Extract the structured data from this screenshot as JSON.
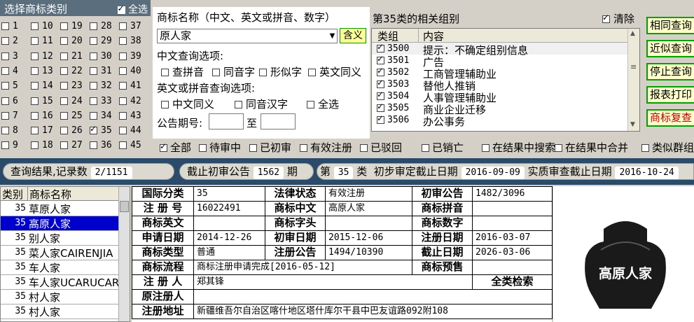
{
  "categories": {
    "header": "选择商标类别",
    "all_label": "全选",
    "items": [
      {
        "n": "1",
        "on": false
      },
      {
        "n": "10",
        "on": false
      },
      {
        "n": "19",
        "on": false
      },
      {
        "n": "28",
        "on": false
      },
      {
        "n": "37",
        "on": false
      },
      {
        "n": "2",
        "on": false
      },
      {
        "n": "11",
        "on": false
      },
      {
        "n": "20",
        "on": false
      },
      {
        "n": "29",
        "on": false
      },
      {
        "n": "38",
        "on": false
      },
      {
        "n": "3",
        "on": false
      },
      {
        "n": "12",
        "on": false
      },
      {
        "n": "21",
        "on": false
      },
      {
        "n": "30",
        "on": false
      },
      {
        "n": "39",
        "on": false
      },
      {
        "n": "4",
        "on": false
      },
      {
        "n": "13",
        "on": false
      },
      {
        "n": "22",
        "on": false
      },
      {
        "n": "31",
        "on": false
      },
      {
        "n": "40",
        "on": false
      },
      {
        "n": "5",
        "on": false
      },
      {
        "n": "14",
        "on": false
      },
      {
        "n": "23",
        "on": false
      },
      {
        "n": "32",
        "on": false
      },
      {
        "n": "41",
        "on": false
      },
      {
        "n": "6",
        "on": false
      },
      {
        "n": "15",
        "on": false
      },
      {
        "n": "24",
        "on": false
      },
      {
        "n": "33",
        "on": false
      },
      {
        "n": "42",
        "on": false
      },
      {
        "n": "7",
        "on": false
      },
      {
        "n": "16",
        "on": false
      },
      {
        "n": "25",
        "on": false
      },
      {
        "n": "34",
        "on": false
      },
      {
        "n": "43",
        "on": false
      },
      {
        "n": "8",
        "on": false
      },
      {
        "n": "17",
        "on": false
      },
      {
        "n": "26",
        "on": false
      },
      {
        "n": "35",
        "on": true
      },
      {
        "n": "44",
        "on": false
      },
      {
        "n": "9",
        "on": false
      },
      {
        "n": "18",
        "on": false
      },
      {
        "n": "27",
        "on": false
      },
      {
        "n": "36",
        "on": false
      },
      {
        "n": "45",
        "on": false
      }
    ]
  },
  "name_search": {
    "label": "商标名称（中文、英文或拼音、数字）",
    "value": "原人家",
    "hanyi_button": "含义",
    "cn_options_label": "中文查询选项:",
    "cn_options": [
      "查拼音",
      "同音字",
      "形似字",
      "英文同义"
    ],
    "en_options_label": "英文或拼音查询选项:",
    "en_options": [
      "中文同义",
      "同音汉字",
      "全选"
    ],
    "gazette_label": "公告期号:",
    "gazette_to": "至"
  },
  "groups": {
    "title": "第35类的相关组别",
    "clear_label": "清除",
    "col_group": "类组",
    "col_content": "内容",
    "rows": [
      {
        "code": "3500",
        "desc": "提示：不确定组别信息"
      },
      {
        "code": "3501",
        "desc": "广告"
      },
      {
        "code": "3502",
        "desc": "工商管理辅助业"
      },
      {
        "code": "3503",
        "desc": "替他人推销"
      },
      {
        "code": "3504",
        "desc": "人事管理辅助业"
      },
      {
        "code": "3505",
        "desc": "商业企业迁移"
      },
      {
        "code": "3506",
        "desc": "办公事务"
      }
    ]
  },
  "actions": [
    {
      "label": "相同查询",
      "red": false
    },
    {
      "label": "近似查询",
      "red": false
    },
    {
      "label": "停止查询",
      "red": false
    },
    {
      "label": "报表打印",
      "red": false
    },
    {
      "label": "商标复查",
      "red": true
    }
  ],
  "filters": [
    {
      "label": "全部",
      "on": true
    },
    {
      "label": "待审中",
      "on": false
    },
    {
      "label": "已初审",
      "on": false
    },
    {
      "label": "有效注册",
      "on": false
    },
    {
      "label": "已驳回",
      "on": false
    },
    {
      "label": "已销亡",
      "on": false
    },
    {
      "label": "在结果中搜索",
      "on": false
    },
    {
      "label": "在结果中合并",
      "on": false
    },
    {
      "label": "类似群组",
      "on": false
    }
  ],
  "status": {
    "result_label": "查询结果,记录数",
    "result_count": "2/1151",
    "cutoff_label": "截止初审公告",
    "cutoff_value": "1562",
    "cutoff_unit": "期",
    "class_prefix": "第",
    "class_value": "35",
    "class_suffix": "类",
    "prelim_label": "初步审定截止日期",
    "prelim_date": "2016-09-09",
    "substantive_label": "实质审查截止日期",
    "substantive_date": "2016-10-24"
  },
  "results": {
    "col_class": "类别",
    "col_name": "商标名称",
    "rows": [
      {
        "c": "35",
        "name": "草原人家",
        "sel": false
      },
      {
        "c": "35",
        "name": "高原人家",
        "sel": true
      },
      {
        "c": "35",
        "name": "别人家",
        "sel": false
      },
      {
        "c": "35",
        "name": "菜人家CAIRENJIA",
        "sel": false
      },
      {
        "c": "35",
        "name": "车人家",
        "sel": false
      },
      {
        "c": "35",
        "name": "车人家UCARUCAR",
        "sel": false
      },
      {
        "c": "35",
        "name": "村人家",
        "sel": false
      },
      {
        "c": "35",
        "name": "村人家",
        "sel": false
      }
    ]
  },
  "detail": {
    "intl_class_k": "国际分类",
    "intl_class_v": "35",
    "legal_status_k": "法律状态",
    "legal_status_v": "有效注册",
    "prelim_gazette_k": "初审公告",
    "prelim_gazette_v": "1482/3096",
    "reg_no_k": "注 册 号",
    "reg_no_v": "16022491",
    "cn_name_k": "商标中文",
    "cn_name_v": "高原人家",
    "pinyin_k": "商标拼音",
    "pinyin_v": "",
    "en_name_k": "商标英文",
    "en_name_v": "",
    "head_k": "商标字头",
    "head_v": "",
    "digits_k": "商标数字",
    "digits_v": "",
    "apply_date_k": "申请日期",
    "apply_date_v": "2014-12-26",
    "prelim_date_k": "初审日期",
    "prelim_date_v": "2015-12-06",
    "reg_date_k": "注册日期",
    "reg_date_v": "2016-03-07",
    "type_k": "商标类型",
    "type_v": "普通",
    "reg_gazette_k": "注册公告",
    "reg_gazette_v": "1494/10390",
    "expiry_k": "截止日期",
    "expiry_v": "2026-03-06",
    "flow_k": "商标流程",
    "flow_v": "商标注册申请完成[2016-05-12]",
    "warning_k": "商标预售",
    "warning_v": "",
    "registrant_k": "注 册 人",
    "registrant_v": "郑其锋",
    "all_class_search": "全类检索",
    "orig_registrant_k": "原注册人",
    "orig_registrant_v": "",
    "address_k": "注册地址",
    "address_v": "新疆维吾尔自治区喀什地区塔什库尔干县中巴友谊路092附108"
  },
  "logo": {
    "text": "高原人家",
    "fill": "#1a1a1a",
    "text_color": "#ffffff"
  }
}
